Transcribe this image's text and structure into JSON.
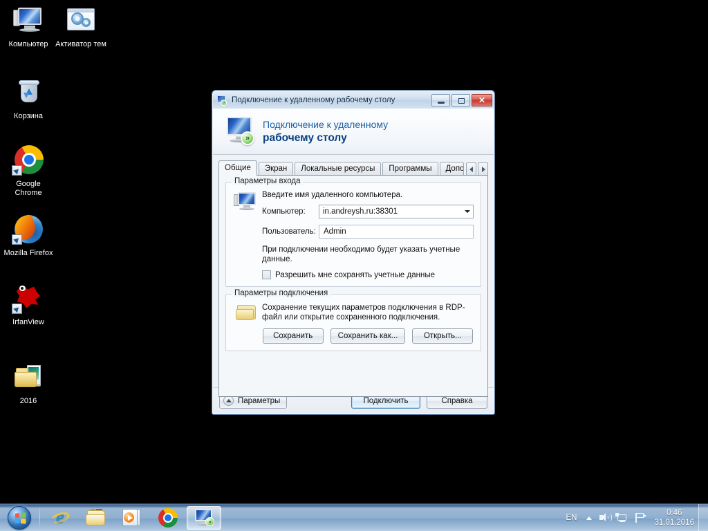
{
  "desktop": {
    "icons": [
      {
        "label": "Компьютер",
        "icon": "computer-icon",
        "shortcut": false
      },
      {
        "label": "Активатор тем",
        "icon": "theme-activator-icon",
        "shortcut": false
      },
      {
        "label": "Корзина",
        "icon": "recycle-bin-icon",
        "shortcut": false
      },
      {
        "label": "Google Chrome",
        "icon": "google-chrome-icon",
        "shortcut": true
      },
      {
        "label": "Mozilla Firefox",
        "icon": "mozilla-firefox-icon",
        "shortcut": true
      },
      {
        "label": "IrfanView",
        "icon": "irfanview-icon",
        "shortcut": true
      },
      {
        "label": "2016",
        "icon": "folder-icon",
        "shortcut": false
      }
    ],
    "background_color": "#000000"
  },
  "dialog": {
    "titlebar": {
      "title": "Подключение к удаленному рабочему столу",
      "icon": "remote-desktop-icon",
      "minimize_label": "",
      "maximize_label": "",
      "close_label": "✕"
    },
    "header": {
      "line1": "Подключение к удаленному",
      "line2": "рабочему столу",
      "icon": "remote-desktop-large-icon",
      "accent_color": "#1c5fa8",
      "accent_bold_color": "#0a3f84"
    },
    "tabs": [
      {
        "label": "Общие",
        "active": true
      },
      {
        "label": "Экран",
        "active": false
      },
      {
        "label": "Локальные ресурсы",
        "active": false
      },
      {
        "label": "Программы",
        "active": false
      },
      {
        "label": "Дополнительны",
        "active": false
      }
    ],
    "tab_scroll": {
      "left": "◄",
      "right": "►"
    },
    "login_group": {
      "legend": "Параметры входа",
      "icon": "monitor-icon",
      "hint": "Введите имя удаленного компьютера.",
      "computer_label": "Компьютер:",
      "computer_value": "in.andreysh.ru:38301",
      "user_label": "Пользователь:",
      "user_value": "Admin",
      "note": "При подключении необходимо будет указать учетные данные.",
      "checkbox_label": "Разрешить мне сохранять учетные данные",
      "checkbox_checked": false
    },
    "connection_group": {
      "legend": "Параметры подключения",
      "icon": "folder-icon",
      "description": "Сохранение текущих параметров подключения в RDP-файл или открытие сохраненного подключения.",
      "buttons": [
        {
          "label": "Сохранить"
        },
        {
          "label": "Сохранить как..."
        },
        {
          "label": "Открыть..."
        }
      ]
    },
    "footer": {
      "options_label": "Параметры",
      "options_icon": "chevron-up-icon",
      "connect_label": "Подключить",
      "help_label": "Справка"
    }
  },
  "taskbar": {
    "start_label": "",
    "start_icon": "windows-start-orb",
    "buttons": [
      {
        "name": "internet-explorer",
        "active": false
      },
      {
        "name": "windows-explorer",
        "active": false
      },
      {
        "name": "windows-media-player",
        "active": false
      },
      {
        "name": "google-chrome",
        "active": false
      },
      {
        "name": "remote-desktop-connection",
        "active": true
      }
    ],
    "tray": {
      "language": "EN",
      "chevron_icon": "show-hidden-icons-icon",
      "volume_icon": "speaker-icon",
      "network_icon": "network-icon",
      "action_center_icon": "flag-icon",
      "time": "0:46",
      "date": "31.01.2016"
    }
  }
}
